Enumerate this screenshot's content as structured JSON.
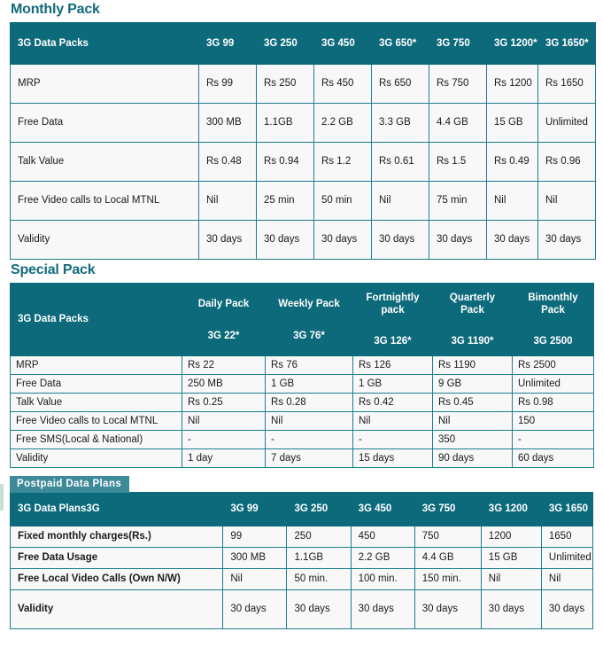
{
  "theme": {
    "teal": "#0d6a7b",
    "teal_light": "#3d8b99",
    "title_color": "#136b7c",
    "cell_bg": "#f7f8f7",
    "border": "#1d7f8f"
  },
  "monthly": {
    "title": "Monthly Pack",
    "headers": [
      "3G Data Packs",
      "3G 99",
      "3G 250",
      "3G 450",
      "3G 650*",
      "3G 750",
      "3G 1200*",
      "3G 1650*"
    ],
    "rows": [
      {
        "label": "MRP",
        "values": [
          "Rs 99",
          "Rs 250",
          "Rs 450",
          "Rs 650",
          "Rs 750",
          "Rs 1200",
          "Rs 1650"
        ]
      },
      {
        "label": "Free Data",
        "values": [
          "300 MB",
          "1.1GB",
          "2.2 GB",
          "3.3 GB",
          "4.4 GB",
          "15 GB",
          "Unlimited"
        ]
      },
      {
        "label": "Talk Value",
        "values": [
          "Rs 0.48",
          "Rs 0.94",
          "Rs 1.2",
          "Rs 0.61",
          "Rs 1.5",
          "Rs 0.49",
          "Rs 0.96"
        ]
      },
      {
        "label": "Free Video calls to Local MTNL",
        "values": [
          "Nil",
          "25 min",
          "50 min",
          "Nil",
          "75 min",
          "Nil",
          "Nil"
        ]
      },
      {
        "label": "Validity",
        "values": [
          "30 days",
          "30 days",
          "30 days",
          "30 days",
          "30 days",
          "30 days",
          "30 days"
        ]
      }
    ]
  },
  "special": {
    "title": "Special Pack",
    "row_label_header": "3G Data Packs",
    "columns": [
      {
        "name": "Daily Pack",
        "code": "3G 22*"
      },
      {
        "name": "Weekly Pack",
        "code": "3G 76*"
      },
      {
        "name": "Fortnightly pack",
        "code": "3G 126*"
      },
      {
        "name": "Quarterly Pack",
        "code": "3G 1190*"
      },
      {
        "name": "Bimonthly Pack",
        "code": "3G 2500"
      }
    ],
    "rows": [
      {
        "label": "MRP",
        "values": [
          "Rs 22",
          "Rs 76",
          "Rs 126",
          "Rs 1190",
          "Rs 2500"
        ]
      },
      {
        "label": "Free Data",
        "values": [
          "250 MB",
          "1 GB",
          "1 GB",
          "9 GB",
          "Unlimited"
        ]
      },
      {
        "label": "Talk Value",
        "values": [
          "Rs 0.25",
          "Rs 0.28",
          "Rs 0.42",
          "Rs 0.45",
          "Rs  0.98"
        ]
      },
      {
        "label": "Free Video calls to Local MTNL",
        "values": [
          "Nil",
          "Nil",
          "Nil",
          "Nil",
          "150"
        ]
      },
      {
        "label": "Free SMS(Local & National)",
        "values": [
          "-",
          "-",
          "-",
          "350",
          "-"
        ]
      },
      {
        "label": "Validity",
        "values": [
          "1 day",
          "7 days",
          "15 days",
          "90 days",
          "60 days"
        ]
      }
    ]
  },
  "postpaid": {
    "tab_label": "Postpaid Data Plans",
    "headers": [
      "3G Data Plans3G",
      "3G 99",
      "3G  250",
      "3G 450",
      "3G  750",
      "3G 1200",
      "3G 1650"
    ],
    "rows": [
      {
        "label": "Fixed monthly charges(Rs.)",
        "values": [
          "99",
          "250",
          "450",
          "750",
          "1200",
          "1650"
        ]
      },
      {
        "label": "Free Data Usage",
        "values": [
          "300 MB",
          "1.1GB",
          "2.2 GB",
          "4.4 GB",
          "15 GB",
          "Unlimited"
        ]
      },
      {
        "label": "Free Local Video Calls (Own N/W)",
        "values": [
          "Nil",
          "50 min.",
          "100 min.",
          "150 min.",
          "Nil",
          "Nil"
        ]
      },
      {
        "label": "Validity",
        "values": [
          "30 days",
          "30 days",
          "30 days",
          "30 days",
          "30 days",
          "30 days"
        ]
      }
    ]
  }
}
